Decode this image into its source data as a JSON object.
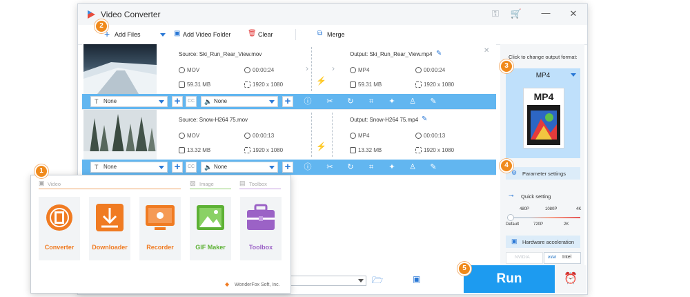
{
  "app": {
    "title": "Video Converter"
  },
  "toolbar": {
    "add_files": "Add Files",
    "add_video_folder": "Add Video Folder",
    "clear": "Clear",
    "merge": "Merge"
  },
  "files": [
    {
      "source": "Source: Ski_Run_Rear_View.mov",
      "output": "Output: Ski_Run_Rear_View.mp4",
      "src_format": "MOV",
      "src_duration": "00:00:24",
      "src_size": "59.31 MB",
      "src_res": "1920 x 1080",
      "out_format": "MP4",
      "out_duration": "00:00:24",
      "out_size": "59.31 MB",
      "out_res": "1920 x 1080",
      "subtitle": "None",
      "audio": "None",
      "cc": "CC"
    },
    {
      "source": "Source: Snow-H264 75.mov",
      "output": "Output: Snow-H264 75.mp4",
      "src_format": "MOV",
      "src_duration": "00:00:13",
      "src_size": "13.32 MB",
      "src_res": "1920 x 1080",
      "out_format": "MP4",
      "out_duration": "00:00:13",
      "out_size": "13.32 MB",
      "out_res": "1920 x 1080",
      "subtitle": "None",
      "audio": "None",
      "cc": "CC"
    }
  ],
  "output_panel": {
    "hint": "Click to change output format:",
    "format": "MP4",
    "icon_label": "MP4",
    "parameter_settings": "Parameter settings",
    "quick_setting": "Quick setting",
    "quality_top": [
      "480P",
      "1080P",
      "4K"
    ],
    "quality_bottom": [
      "Default",
      "720P",
      "2K"
    ],
    "quality_level": 0,
    "hardware_acceleration": "Hardware acceleration",
    "nvidia": "NVIDIA",
    "intel_brand": "intel",
    "intel": "Intel"
  },
  "run": {
    "label": "Run"
  },
  "launcher": {
    "categories": {
      "video": "Video",
      "image": "Image",
      "toolbox": "Toolbox"
    },
    "tiles": [
      {
        "label": "Converter",
        "icon": "film-reel-icon",
        "color": "#f07b22"
      },
      {
        "label": "Downloader",
        "icon": "download-icon",
        "color": "#f07b22"
      },
      {
        "label": "Recorder",
        "icon": "screen-record-icon",
        "color": "#f07b22"
      },
      {
        "label": "GIF Maker",
        "icon": "image-icon",
        "color": "#5db135"
      },
      {
        "label": "Toolbox",
        "icon": "toolbox-icon",
        "color": "#9b62c6"
      }
    ],
    "footer": "WonderFox Soft, Inc."
  },
  "badges": [
    "1",
    "2",
    "3",
    "4",
    "5"
  ],
  "colors": {
    "accent": "#1d9bf0",
    "bar": "#62b6f0",
    "badge": "#f08a1c",
    "format_box": "#bfe0fb"
  }
}
